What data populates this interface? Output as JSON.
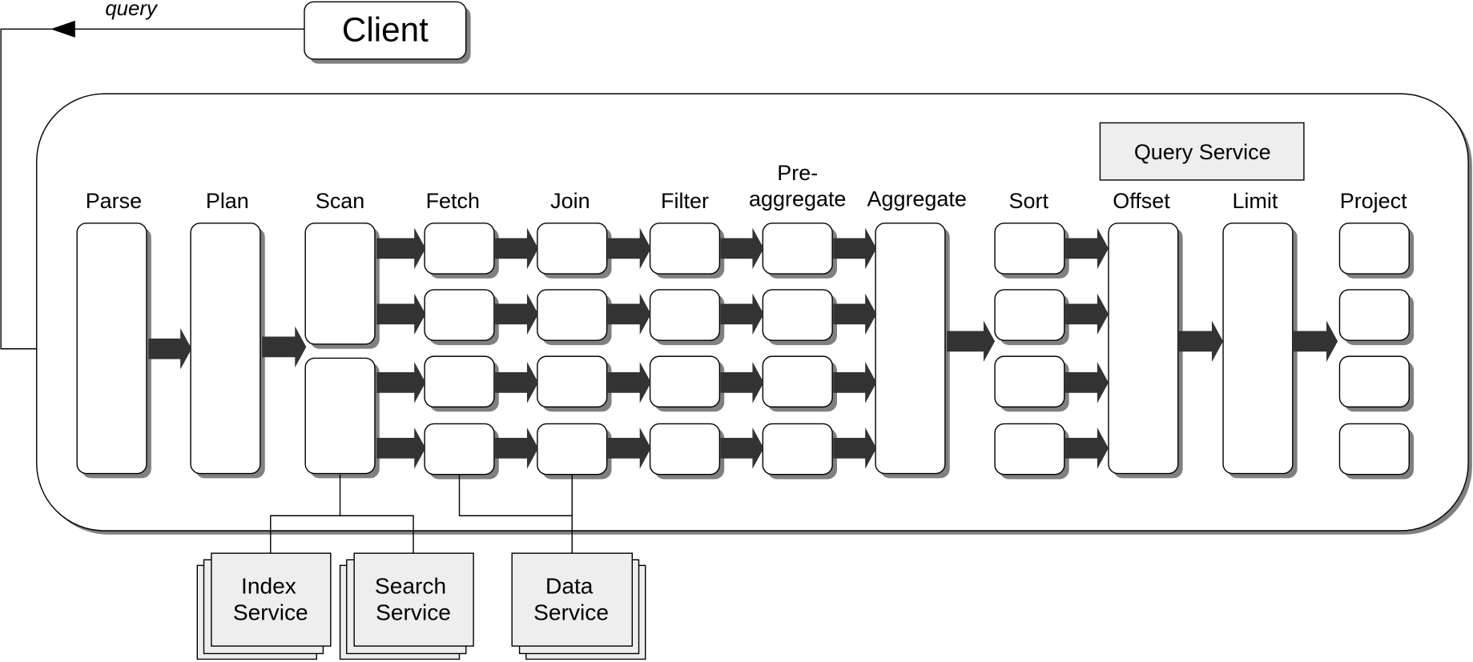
{
  "client": {
    "label": "Client"
  },
  "query_edge": {
    "label": "query"
  },
  "container": {
    "label": "Query Service"
  },
  "stages": [
    {
      "id": "parse",
      "label": "Parse",
      "lanes": 1
    },
    {
      "id": "plan",
      "label": "Plan",
      "lanes": 1
    },
    {
      "id": "scan",
      "label": "Scan",
      "lanes": 2
    },
    {
      "id": "fetch",
      "label": "Fetch",
      "lanes": 4
    },
    {
      "id": "join",
      "label": "Join",
      "lanes": 4
    },
    {
      "id": "filter",
      "label": "Filter",
      "lanes": 4
    },
    {
      "id": "pre-aggregate",
      "label_line1": "Pre-",
      "label_line2": "aggregate",
      "lanes": 4
    },
    {
      "id": "aggregate",
      "label": "Aggregate",
      "lanes": 1
    },
    {
      "id": "sort",
      "label": "Sort",
      "lanes": 4
    },
    {
      "id": "offset",
      "label": "Offset",
      "lanes": 1
    },
    {
      "id": "limit",
      "label": "Limit",
      "lanes": 1
    },
    {
      "id": "project",
      "label": "Project",
      "lanes": 4
    }
  ],
  "services": [
    {
      "id": "index",
      "line1": "Index",
      "line2": "Service",
      "connected_to": "scan"
    },
    {
      "id": "search",
      "line1": "Search",
      "line2": "Service",
      "connected_to": "scan"
    },
    {
      "id": "data",
      "line1": "Data",
      "line2": "Service",
      "connected_to": [
        "fetch",
        "join"
      ]
    }
  ],
  "colors": {
    "arrow": "#333333",
    "shadow": "#808080",
    "service_fill": "#eeeeee",
    "box_fill": "#ffffff",
    "stroke": "#000000"
  }
}
